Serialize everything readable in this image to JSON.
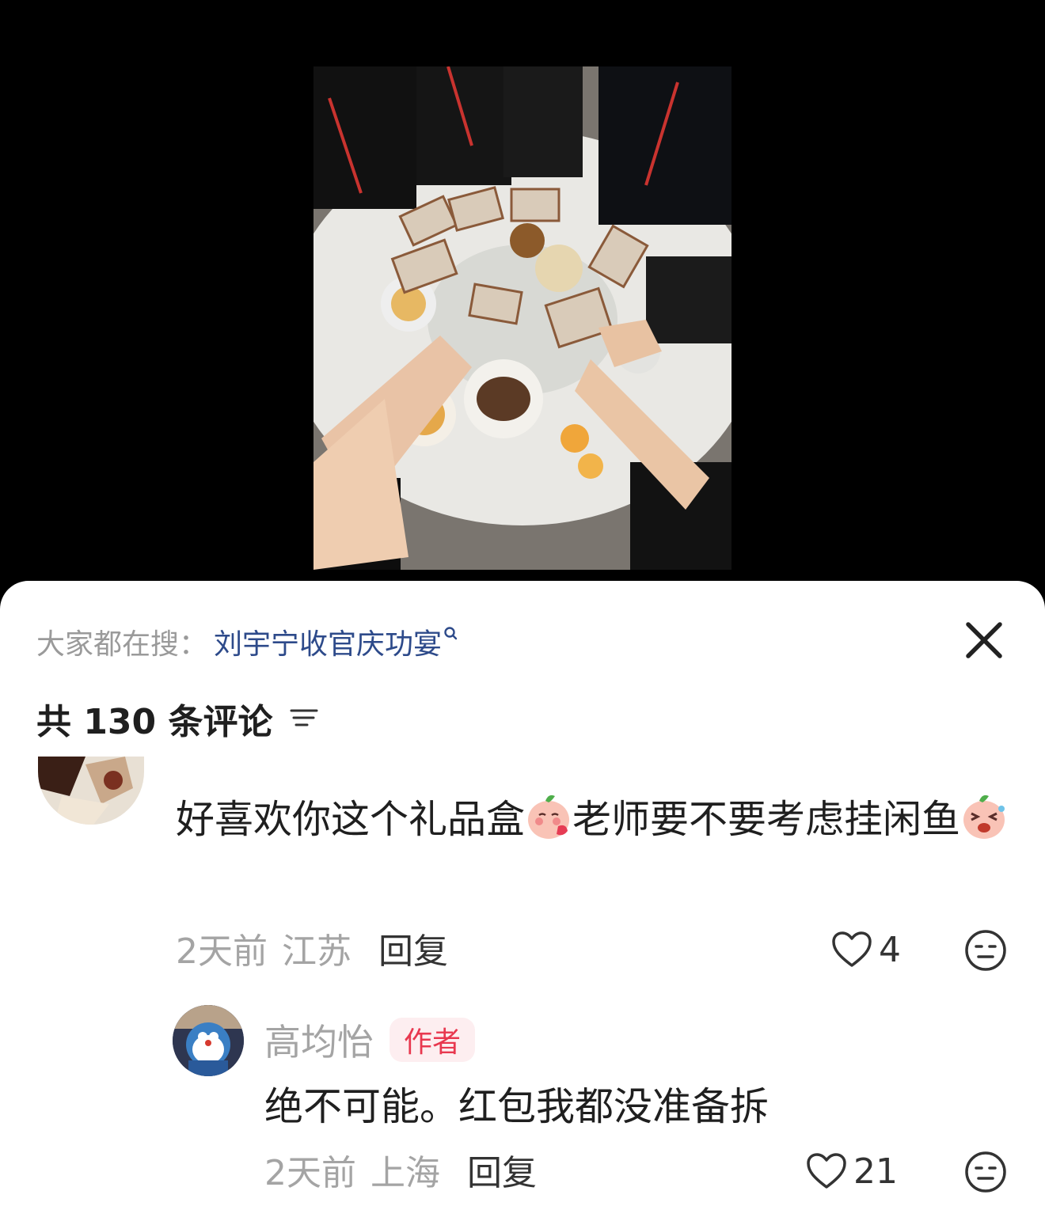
{
  "colors": {
    "sheet_bg": "#ffffff",
    "search_term": "#2d4a8a",
    "muted": "#a4a4a4",
    "author_badge_bg": "#fdeef0",
    "author_badge_text": "#e8384f"
  },
  "post_photo": {
    "icon": "banquet-photo"
  },
  "search": {
    "prefix": "大家都在搜：",
    "term": "刘宇宁收官庆功宴"
  },
  "comments_header": {
    "count_label": "共 130 条评论"
  },
  "comments": [
    {
      "avatar_icon": "user-avatar",
      "text_part1": "好喜欢你这个礼品盒",
      "emoji1": "blush-emoji",
      "text_part2": "老师要不要考虑挂闲鱼",
      "emoji2": "excited-emoji",
      "time": "2天前",
      "location": "江苏",
      "reply_label": "回复",
      "likes": "4"
    }
  ],
  "replies": [
    {
      "avatar_icon": "doraemon-avatar",
      "name": "高均怡",
      "badge": "作者",
      "text": "绝不可能。红包我都没准备拆",
      "time": "2天前",
      "location": "上海",
      "reply_label": "回复",
      "likes": "21"
    }
  ]
}
